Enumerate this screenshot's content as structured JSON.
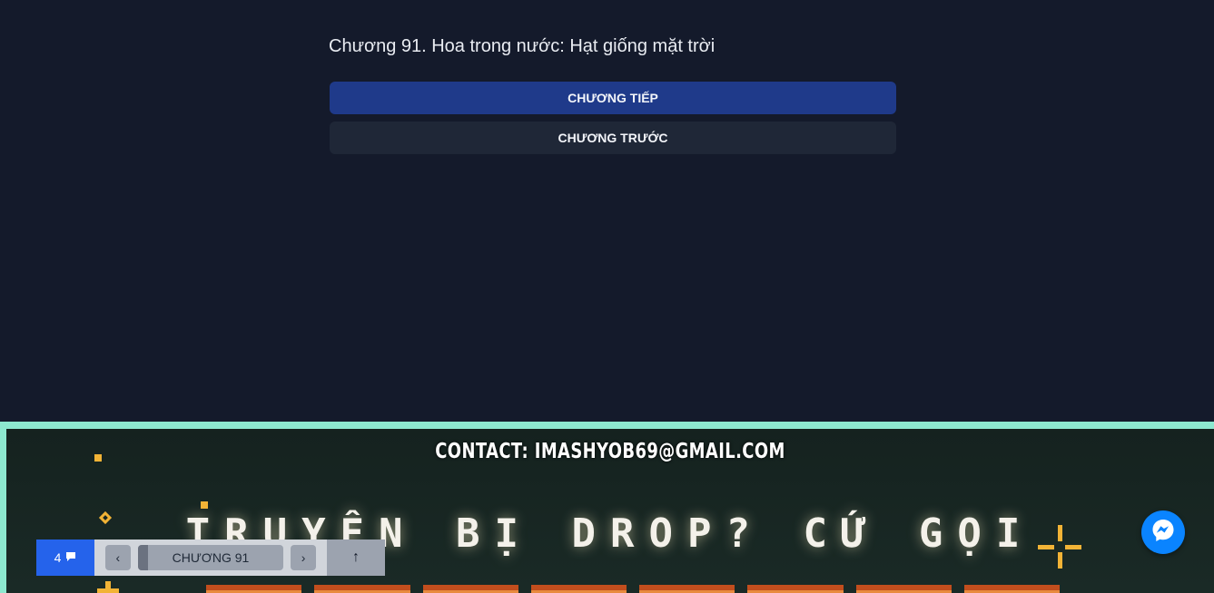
{
  "chapter": {
    "title": "Chương 91. Hoa trong nước: Hạt giống mặt trời",
    "next_label": "CHƯƠNG TIẾP",
    "prev_label": "CHƯƠNG TRƯỚC"
  },
  "banner": {
    "contact": "CONTACT: IMASHYOB69@GMAIL.COM",
    "headline": "TRUYỆN BỊ DROP? CỨ GỌI"
  },
  "toolbar": {
    "comment_count": "4",
    "current_chapter": "CHƯƠNG 91",
    "prev_symbol": "‹",
    "next_symbol": "›",
    "top_symbol": "↑"
  },
  "colors": {
    "background": "#141a2b",
    "next_button": "#1f3a8a",
    "prev_button": "#1f2737",
    "banner_border": "#8de8cf",
    "accent_yellow": "#f2b336",
    "comment_button": "#2563eb",
    "messenger": "#0a84ff"
  },
  "icons": {
    "comments": "speech-bubble-icon",
    "messenger": "messenger-icon",
    "prev": "chevron-left-icon",
    "next": "chevron-right-icon",
    "top": "arrow-up-icon"
  }
}
